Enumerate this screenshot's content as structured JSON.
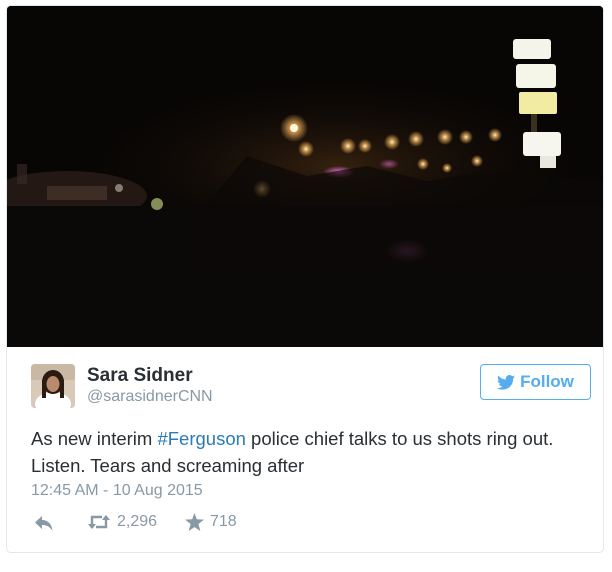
{
  "media": {
    "description_icon": "video-still"
  },
  "author": {
    "display_name": "Sara Sidner",
    "handle": "@sarasidnerCNN",
    "avatar_icon": "profile-photo"
  },
  "follow_button": {
    "label": "Follow",
    "icon": "twitter-bird-icon",
    "color": "#55acee"
  },
  "tweet": {
    "text_before": "As new interim ",
    "hashtag": "#Ferguson",
    "text_after": " police chief talks to us shots ring out. Listen. Tears and screaming after",
    "hashtag_color": "#2b7bb9"
  },
  "timestamp": "12:45 AM - 10 Aug 2015",
  "actions": {
    "reply_icon": "reply-icon",
    "retweet_icon": "retweet-icon",
    "retweet_count": "2,296",
    "favorite_icon": "star-icon",
    "favorite_count": "718"
  }
}
